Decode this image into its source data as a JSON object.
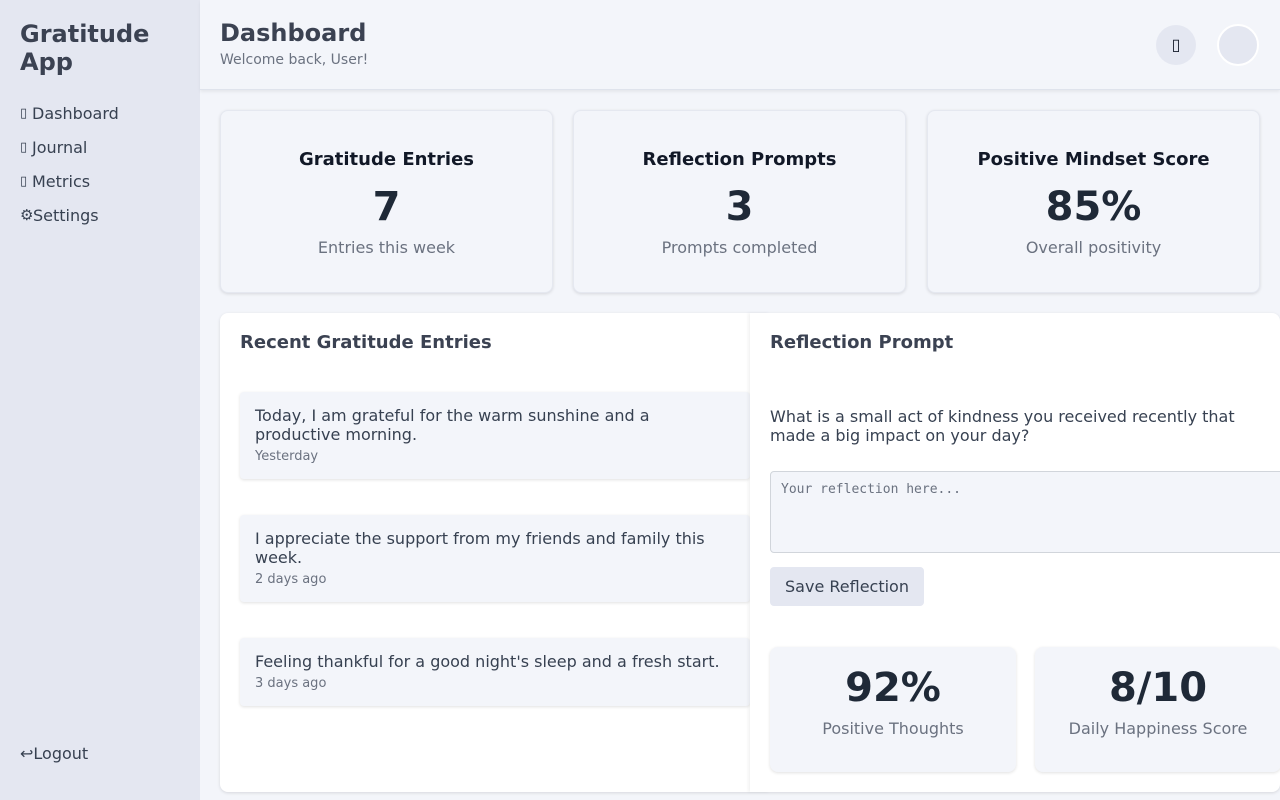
{
  "sidebar": {
    "app_title": "Gratitude App",
    "items": [
      {
        "icon": "▯",
        "label": "Dashboard",
        "icon_name": "home-icon"
      },
      {
        "icon": "▯",
        "label": "Journal",
        "icon_name": "book-icon"
      },
      {
        "icon": "▯",
        "label": "Metrics",
        "icon_name": "chart-icon"
      },
      {
        "icon": "⚙",
        "label": "Settings",
        "icon_name": "gear-icon"
      }
    ],
    "logout": {
      "icon": "↩",
      "label": "Logout"
    }
  },
  "header": {
    "title": "Dashboard",
    "subtitle": "Welcome back, User!",
    "action_icon": "▯"
  },
  "stats": [
    {
      "title": "Gratitude Entries",
      "value": "7",
      "desc": "Entries this week"
    },
    {
      "title": "Reflection Prompts",
      "value": "3",
      "desc": "Prompts completed"
    },
    {
      "title": "Positive Mindset Score",
      "value": "85%",
      "desc": "Overall positivity"
    }
  ],
  "recent_entries": {
    "title": "Recent Gratitude Entries",
    "items": [
      {
        "text": "Today, I am grateful for the warm sunshine and a productive morning.",
        "date": "Yesterday"
      },
      {
        "text": "I appreciate the support from my friends and family this week.",
        "date": "2 days ago"
      },
      {
        "text": "Feeling thankful for a good night's sleep and a fresh start.",
        "date": "3 days ago"
      }
    ]
  },
  "reflection": {
    "title": "Reflection Prompt",
    "prompt": "What is a small act of kindness you received recently that made a big impact on your day?",
    "placeholder": "Your reflection here...",
    "save_label": "Save Reflection"
  },
  "mini_stats": [
    {
      "value": "92%",
      "desc": "Positive Thoughts"
    },
    {
      "value": "8/10",
      "desc": "Daily Happiness Score"
    }
  ]
}
